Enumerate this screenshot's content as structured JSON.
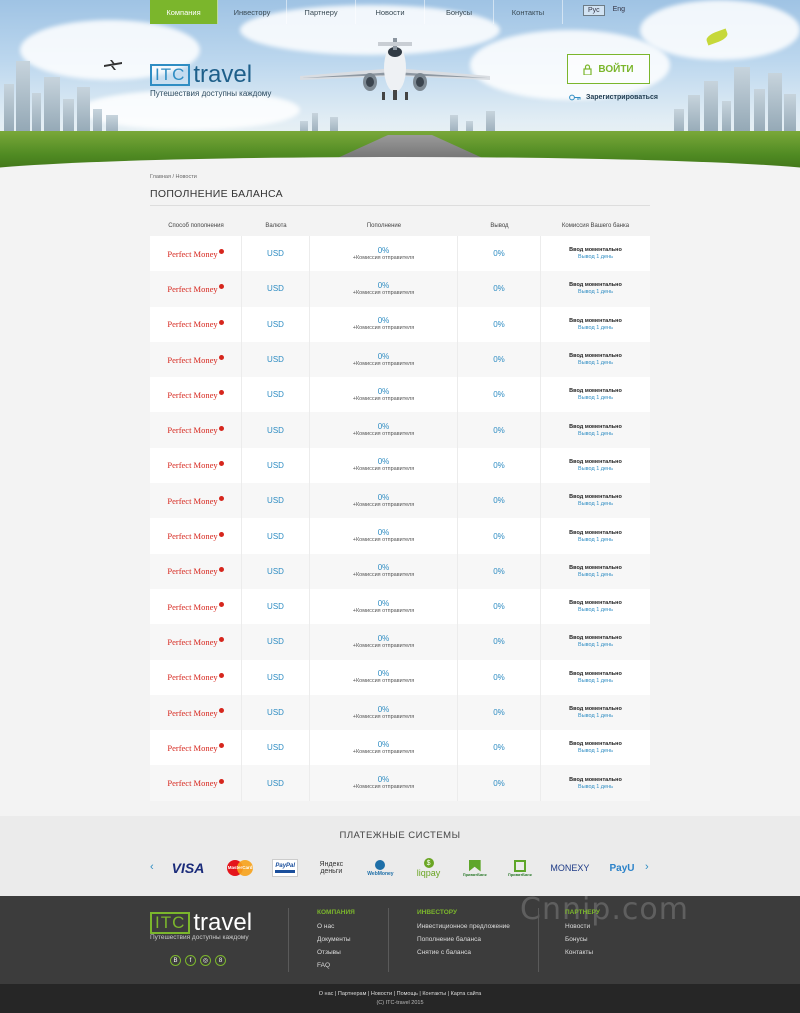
{
  "nav": {
    "items": [
      "Компания",
      "Инвестору",
      "Партнеру",
      "Новости",
      "Бонусы",
      "Контакты"
    ],
    "lang": [
      "Рус",
      "Eng"
    ]
  },
  "brand": {
    "itc": "ITC",
    "travel": "travel",
    "slogan": "Путешествия доступны каждому"
  },
  "auth": {
    "login": "ВОЙТИ",
    "register": "Зарегистрироваться"
  },
  "breadcrumb": {
    "home": "Главная",
    "sep": "/",
    "current": "Новости"
  },
  "page_title": "ПОПОЛНЕНИЕ БАЛАНСА",
  "table": {
    "headers": [
      "Способ пополнения",
      "Валюта",
      "Пополнение",
      "Вывод",
      "Комиссия Вашего банка"
    ],
    "rows": [
      {
        "method": "Perfect Money",
        "currency": "USD",
        "deposit": "0%",
        "deposit_note": "+Комиссия отправителя",
        "withdraw": "0%",
        "bank_in": "Ввод моментально",
        "bank_out": "Вывод 1 день"
      },
      {
        "method": "Perfect Money",
        "currency": "USD",
        "deposit": "0%",
        "deposit_note": "+Комиссия отправителя",
        "withdraw": "0%",
        "bank_in": "Ввод моментально",
        "bank_out": "Вывод 1 день"
      },
      {
        "method": "Perfect Money",
        "currency": "USD",
        "deposit": "0%",
        "deposit_note": "+Комиссия отправителя",
        "withdraw": "0%",
        "bank_in": "Ввод моментально",
        "bank_out": "Вывод 1 день"
      },
      {
        "method": "Perfect Money",
        "currency": "USD",
        "deposit": "0%",
        "deposit_note": "+Комиссия отправителя",
        "withdraw": "0%",
        "bank_in": "Ввод моментально",
        "bank_out": "Вывод 1 день"
      },
      {
        "method": "Perfect Money",
        "currency": "USD",
        "deposit": "0%",
        "deposit_note": "+Комиссия отправителя",
        "withdraw": "0%",
        "bank_in": "Ввод моментально",
        "bank_out": "Вывод 1 день"
      },
      {
        "method": "Perfect Money",
        "currency": "USD",
        "deposit": "0%",
        "deposit_note": "+Комиссия отправителя",
        "withdraw": "0%",
        "bank_in": "Ввод моментально",
        "bank_out": "Вывод 1 день"
      },
      {
        "method": "Perfect Money",
        "currency": "USD",
        "deposit": "0%",
        "deposit_note": "+Комиссия отправителя",
        "withdraw": "0%",
        "bank_in": "Ввод моментально",
        "bank_out": "Вывод 1 день"
      },
      {
        "method": "Perfect Money",
        "currency": "USD",
        "deposit": "0%",
        "deposit_note": "+Комиссия отправителя",
        "withdraw": "0%",
        "bank_in": "Ввод моментально",
        "bank_out": "Вывод 1 день"
      },
      {
        "method": "Perfect Money",
        "currency": "USD",
        "deposit": "0%",
        "deposit_note": "+Комиссия отправителя",
        "withdraw": "0%",
        "bank_in": "Ввод моментально",
        "bank_out": "Вывод 1 день"
      },
      {
        "method": "Perfect Money",
        "currency": "USD",
        "deposit": "0%",
        "deposit_note": "+Комиссия отправителя",
        "withdraw": "0%",
        "bank_in": "Ввод моментально",
        "bank_out": "Вывод 1 день"
      },
      {
        "method": "Perfect Money",
        "currency": "USD",
        "deposit": "0%",
        "deposit_note": "+Комиссия отправителя",
        "withdraw": "0%",
        "bank_in": "Ввод моментально",
        "bank_out": "Вывод 1 день"
      },
      {
        "method": "Perfect Money",
        "currency": "USD",
        "deposit": "0%",
        "deposit_note": "+Комиссия отправителя",
        "withdraw": "0%",
        "bank_in": "Ввод моментально",
        "bank_out": "Вывод 1 день"
      },
      {
        "method": "Perfect Money",
        "currency": "USD",
        "deposit": "0%",
        "deposit_note": "+Комиссия отправителя",
        "withdraw": "0%",
        "bank_in": "Ввод моментально",
        "bank_out": "Вывод 1 день"
      },
      {
        "method": "Perfect Money",
        "currency": "USD",
        "deposit": "0%",
        "deposit_note": "+Комиссия отправителя",
        "withdraw": "0%",
        "bank_in": "Ввод моментально",
        "bank_out": "Вывод 1 день"
      },
      {
        "method": "Perfect Money",
        "currency": "USD",
        "deposit": "0%",
        "deposit_note": "+Комиссия отправителя",
        "withdraw": "0%",
        "bank_in": "Ввод моментально",
        "bank_out": "Вывод 1 день"
      },
      {
        "method": "Perfect Money",
        "currency": "USD",
        "deposit": "0%",
        "deposit_note": "+Комиссия отправителя",
        "withdraw": "0%",
        "bank_in": "Ввод моментально",
        "bank_out": "Вывод 1 день"
      }
    ]
  },
  "payments": {
    "title": "ПЛАТЕЖНЫЕ СИСТЕМЫ",
    "logos": [
      "VISA",
      "MasterCard",
      "PayPal",
      "Яндекс деньги",
      "WebMoney",
      "liqpay",
      "ПриватБанк",
      "ПриватБанк",
      "MONEXY",
      "PayU"
    ]
  },
  "footer": {
    "columns": [
      {
        "title": "КОМПАНИЯ",
        "links": [
          "О нас",
          "Документы",
          "Отзывы",
          "FAQ"
        ]
      },
      {
        "title": "ИНВЕСТОРУ",
        "links": [
          "Инвестиционное предложение",
          "Пополнение баланса",
          "Снятие с баланса"
        ]
      },
      {
        "title": "ПАРТНЕРУ",
        "links": [
          "Новости",
          "Бонусы",
          "Контакты"
        ]
      }
    ],
    "socials": [
      "В",
      "f",
      "◎",
      "8"
    ],
    "watermark": "Cnnip.com",
    "bottom_links": "О нас | Партнерам | Новости | Помощь | Контакты | Карта сайта",
    "copyright": "(С) ITC-travel 2015"
  },
  "colors": {
    "accent_green": "#7bb62c",
    "accent_blue": "#2f8dc3",
    "pm_red": "#d6261d"
  }
}
